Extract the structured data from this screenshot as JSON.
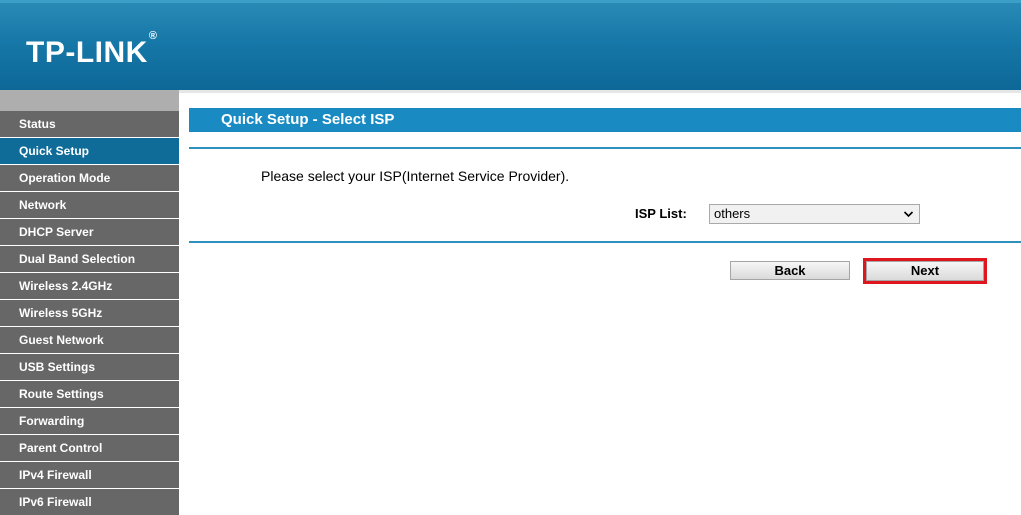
{
  "header": {
    "logo_text": "TP-LINK",
    "logo_mark": "®"
  },
  "sidebar": {
    "items": [
      {
        "label": "Status"
      },
      {
        "label": "Quick Setup"
      },
      {
        "label": "Operation Mode"
      },
      {
        "label": "Network"
      },
      {
        "label": "DHCP Server"
      },
      {
        "label": "Dual Band Selection"
      },
      {
        "label": "Wireless 2.4GHz"
      },
      {
        "label": "Wireless 5GHz"
      },
      {
        "label": "Guest Network"
      },
      {
        "label": "USB Settings"
      },
      {
        "label": "Route Settings"
      },
      {
        "label": "Forwarding"
      },
      {
        "label": "Parent Control"
      },
      {
        "label": "IPv4 Firewall"
      },
      {
        "label": "IPv6 Firewall"
      }
    ],
    "active": "Quick Setup"
  },
  "main": {
    "title": "Quick Setup - Select ISP",
    "instruction": "Please select your ISP(Internet Service Provider).",
    "isp_label": "ISP List:",
    "isp_selected": "others",
    "back_label": "Back",
    "next_label": "Next"
  },
  "colors": {
    "header_blue": "#1678a8",
    "title_bar": "#1a8bc2",
    "nav_bg": "#676767",
    "nav_active": "#0f6c99",
    "highlight": "#e0161f"
  }
}
